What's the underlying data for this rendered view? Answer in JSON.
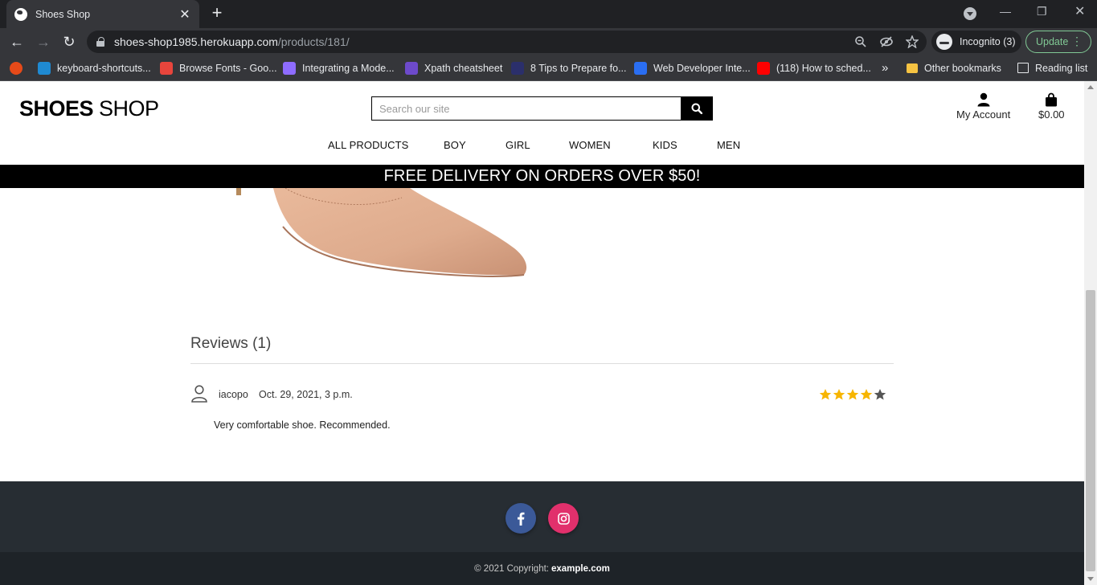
{
  "browser": {
    "tab_title": "Shoes Shop",
    "tab_close": "✕",
    "new_tab": "+",
    "url_host": "shoes-shop1985.herokuapp.com",
    "url_path": "/products/181/",
    "incognito_label": "Incognito (3)",
    "update_label": "Update",
    "bookmarks": [
      {
        "label": "keyboard-shortcuts...",
        "color": "#1f8ad2"
      },
      {
        "label": "Browse Fonts - Goo...",
        "color": "#e8453c"
      },
      {
        "label": "Integrating a Mode...",
        "color": "#8e6cff"
      },
      {
        "label": "Xpath cheatsheet",
        "color": "#6d4acb"
      },
      {
        "label": "8 Tips to Prepare fo...",
        "color": "#2b2f6b"
      },
      {
        "label": "Web Developer Inte...",
        "color": "#2a6ef2"
      },
      {
        "label": "(118) How to sched...",
        "color": "#ff0000"
      }
    ],
    "bookmarks_overflow": "»",
    "other_bookmarks": "Other bookmarks",
    "reading_list": "Reading list"
  },
  "site": {
    "logo_bold": "SHOES",
    "logo_light": " SHOP",
    "search_placeholder": "Search our site",
    "account_label": "My Account",
    "cart_total": "$0.00",
    "nav": [
      "ALL PRODUCTS",
      "BOY",
      "GIRL",
      "WOMEN",
      "KIDS",
      "MEN"
    ],
    "banner": "FREE DELIVERY ON ORDERS OVER $50!",
    "reviews_title": "Reviews (1)",
    "review": {
      "author": "iacopo",
      "date": "Oct. 29, 2021, 3 p.m.",
      "rating": 4,
      "max_rating": 5,
      "text": "Very comfortable shoe. Recommended."
    },
    "footer": {
      "copyright_prefix": "© 2021 Copyright:",
      "copyright_link": "example.com"
    }
  },
  "colors": {
    "star_filled": "#f7b500",
    "star_empty": "#555555",
    "facebook": "#3b5998",
    "instagram": "#e1306c",
    "footer_bg": "#272d33"
  }
}
